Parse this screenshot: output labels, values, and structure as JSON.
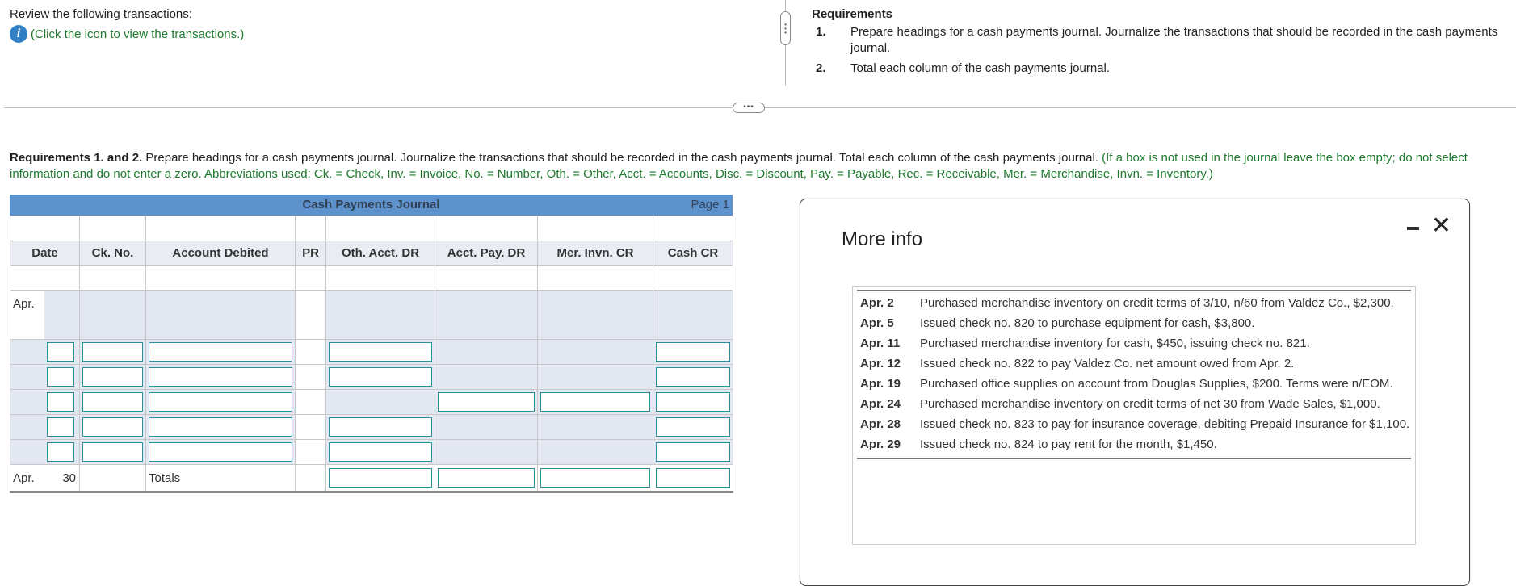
{
  "review": {
    "text": "Review the following transactions:",
    "link": "(Click the icon to view the transactions.)",
    "icon": "info-icon"
  },
  "requirements": {
    "title": "Requirements",
    "items": [
      {
        "num": "1.",
        "text": "Prepare headings for a cash payments journal. Journalize the transactions that should be recorded in the cash payments journal."
      },
      {
        "num": "2.",
        "text": "Total each column of the cash payments journal."
      }
    ]
  },
  "instructions": {
    "bold": "Requirements 1. and 2.",
    "text": " Prepare headings for a cash payments journal. Journalize the transactions that should be recorded in the cash payments journal. Total each column of the cash payments journal. ",
    "note": "(If a box is not used in the journal leave the box empty; do not select information and do not enter a zero. Abbreviations used: Ck. = Check, Inv. = Invoice, No. = Number, Oth. = Other, Acct. = Accounts, Disc. = Discount, Pay. = Payable, Rec. = Receivable, Mer. = Merchandise, Invn. = Inventory.)"
  },
  "journal": {
    "title": "Cash Payments Journal",
    "page": "Page 1",
    "columns": [
      "Date",
      "Ck. No.",
      "Account Debited",
      "PR",
      "Oth. Acct. DR",
      "Acct. Pay. DR",
      "Mer. Invn. CR",
      "Cash CR"
    ],
    "month_label": "Apr.",
    "totals": {
      "month": "Apr.",
      "day": "30",
      "label": "Totals"
    }
  },
  "dialog": {
    "title": "More info",
    "transactions": [
      {
        "date": "Apr. 2",
        "text": "Purchased merchandise inventory on credit terms of 3/10, n/60 from Valdez Co., $2,300."
      },
      {
        "date": "Apr. 5",
        "text": "Issued check no. 820 to purchase equipment for cash, $3,800."
      },
      {
        "date": "Apr. 11",
        "text": "Purchased merchandise inventory for cash, $450, issuing check no. 821."
      },
      {
        "date": "Apr. 12",
        "text": "Issued check no. 822 to pay Valdez Co. net amount owed from Apr. 2."
      },
      {
        "date": "Apr. 19",
        "text": "Purchased office supplies on account from Douglas Supplies, $200. Terms were n/EOM."
      },
      {
        "date": "Apr. 24",
        "text": "Purchased merchandise inventory on credit terms of net 30 from Wade Sales, $1,000."
      },
      {
        "date": "Apr. 28",
        "text": "Issued check no. 823 to pay for insurance coverage, debiting Prepaid Insurance for $1,100."
      },
      {
        "date": "Apr. 29",
        "text": "Issued check no. 824 to pay rent for the month, $1,450."
      }
    ]
  },
  "colors": {
    "header_blue": "#5e92cd",
    "input_border": "#2a8f99",
    "note_green": "#1d7a2d",
    "info_icon": "#2f7fc4"
  }
}
